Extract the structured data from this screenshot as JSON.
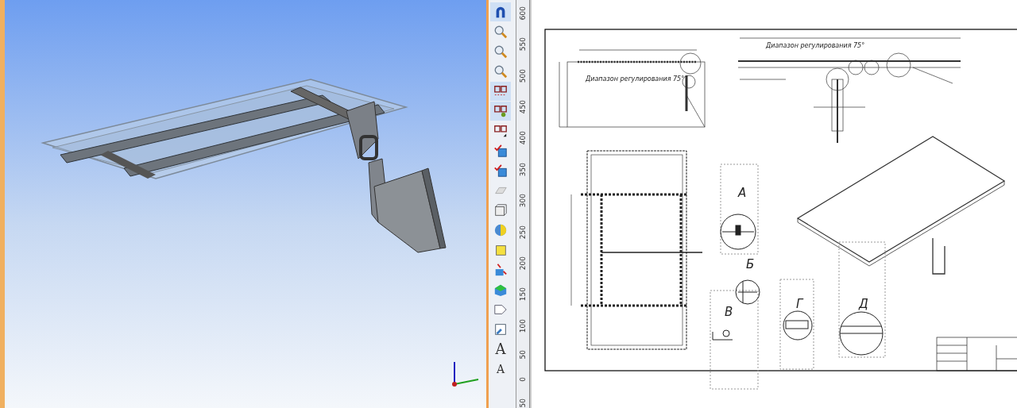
{
  "toolbar": [
    {
      "selected": true
    },
    {
      "selected": false
    },
    {
      "selected": false
    },
    {
      "selected": false
    },
    {
      "selected": true
    },
    {
      "selected": true
    },
    {
      "selected": false
    },
    {
      "selected": false
    },
    {
      "selected": false
    },
    {
      "selected": false
    },
    {
      "selected": false
    },
    {
      "selected": false
    },
    {
      "selected": false
    },
    {
      "selected": false
    },
    {
      "selected": false
    },
    {
      "selected": false
    },
    {
      "selected": false
    },
    {
      "selected": false,
      "label": "A"
    },
    {
      "selected": false,
      "label": "A"
    }
  ],
  "ruler": [
    "600",
    "550",
    "500",
    "450",
    "400",
    "350",
    "300",
    "250",
    "200",
    "150",
    "100",
    "50",
    "0",
    "50"
  ],
  "sheet": {
    "notes": [
      "Диапазон регулирования 75°",
      "Диапазон регулирования 75°"
    ],
    "views": [
      "А",
      "Б",
      "В",
      "Г",
      "Д"
    ]
  }
}
